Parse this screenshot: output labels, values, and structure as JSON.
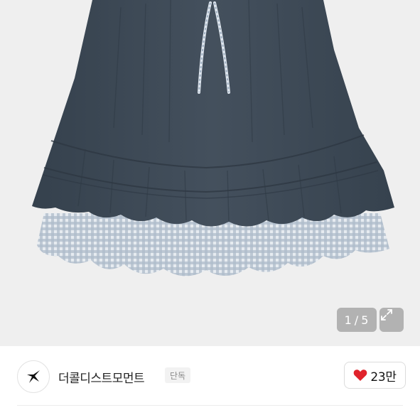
{
  "gallery": {
    "image_alt": "product-photo-skirt",
    "counter": {
      "current": "1",
      "separator": "/",
      "total": "5"
    },
    "expand_icon": "expand-arrows-icon"
  },
  "seller": {
    "logo_icon": "star-swoosh-logo-icon",
    "name": "더콜디스트모먼트",
    "badge": "단독"
  },
  "like": {
    "icon": "heart-icon",
    "count": "23만",
    "heart_color": "#e0232b"
  },
  "colors": {
    "skirt_navy": "#3e4a57",
    "gingham": "#c9d2dc",
    "background": "#efefef"
  }
}
